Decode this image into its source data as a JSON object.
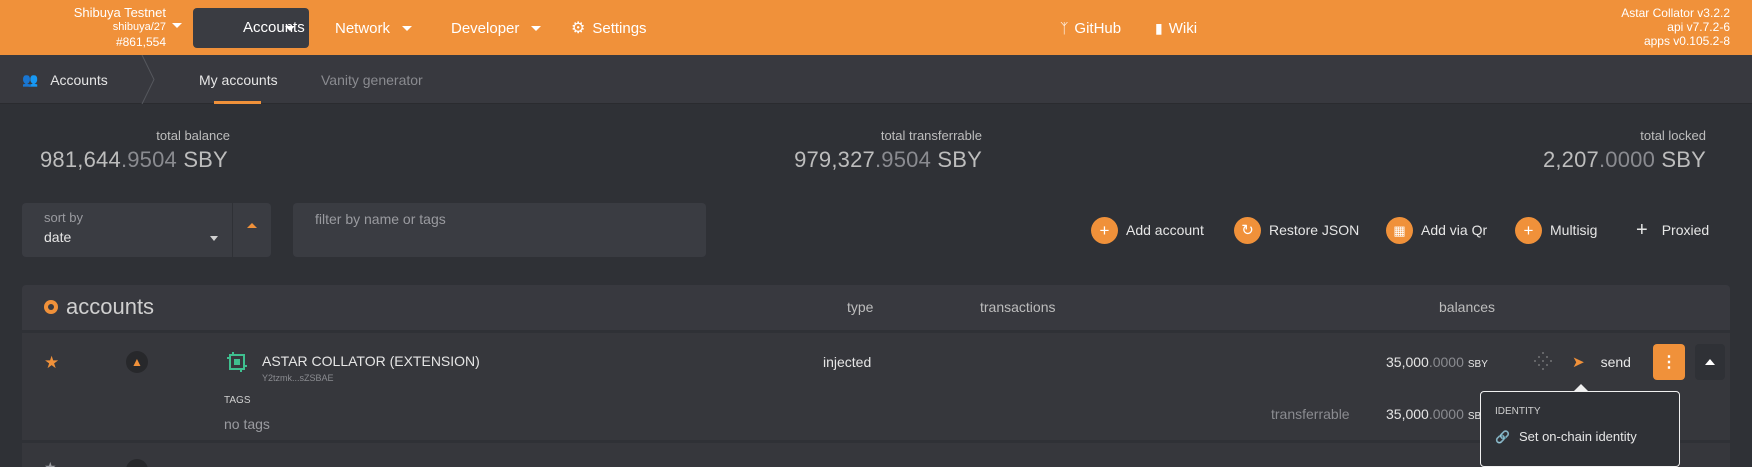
{
  "topbar": {
    "chain_name": "Shibuya Testnet",
    "chain_spec": "shibuya/27",
    "block": "#861,554",
    "nav": [
      {
        "label": "Accounts"
      },
      {
        "label": "Network"
      },
      {
        "label": "Developer"
      },
      {
        "label": "Settings"
      },
      {
        "label": "GitHub"
      },
      {
        "label": "Wiki"
      }
    ],
    "version_lines": [
      "Astar Collator v3.2.2",
      "api v7.7.2-6",
      "apps v0.105.2-8"
    ]
  },
  "subbar": {
    "section": "Accounts",
    "tabs": [
      {
        "label": "My accounts",
        "active": true
      },
      {
        "label": "Vanity generator",
        "active": false
      }
    ]
  },
  "summary": {
    "total_balance": {
      "label": "total balance",
      "int": "981,644",
      "dec": ".9504",
      "unit": "SBY"
    },
    "total_transferrable": {
      "label": "total transferrable",
      "int": "979,327",
      "dec": ".9504",
      "unit": "SBY"
    },
    "total_locked": {
      "label": "total locked",
      "int": "2,207",
      "dec": ".0000",
      "unit": "SBY"
    }
  },
  "controls": {
    "sort_label": "sort by",
    "sort_value": "date",
    "filter_placeholder": "filter by name or tags",
    "actions": [
      {
        "label": "Add account",
        "icon": "plus-icon"
      },
      {
        "label": "Restore JSON",
        "icon": "sync-icon"
      },
      {
        "label": "Add via Qr",
        "icon": "qrcode-icon"
      },
      {
        "label": "Multisig",
        "icon": "plus-icon"
      },
      {
        "label": "Proxied",
        "icon": "plus-icon"
      }
    ]
  },
  "table": {
    "title": "accounts",
    "headers": {
      "type": "type",
      "transactions": "transactions",
      "balances": "balances"
    },
    "rows": [
      {
        "name": "ASTAR COLLATOR (EXTENSION)",
        "address": "Y2tzmk...sZSBAE",
        "type": "injected",
        "balance_int": "35,000",
        "balance_dec": ".0000",
        "unit": "SBY",
        "tags_label": "TAGS",
        "tags_value": "no tags",
        "transferrable_label": "transferrable",
        "transferrable_int": "35,000",
        "transferrable_dec": ".0000",
        "transferrable_unit": "SB",
        "send_label": "send"
      }
    ]
  },
  "popup": {
    "heading": "IDENTITY",
    "item": "Set on-chain identity"
  },
  "colors": {
    "accent": "#f0913a",
    "background": "#2f3136",
    "panel": "#38393f"
  }
}
